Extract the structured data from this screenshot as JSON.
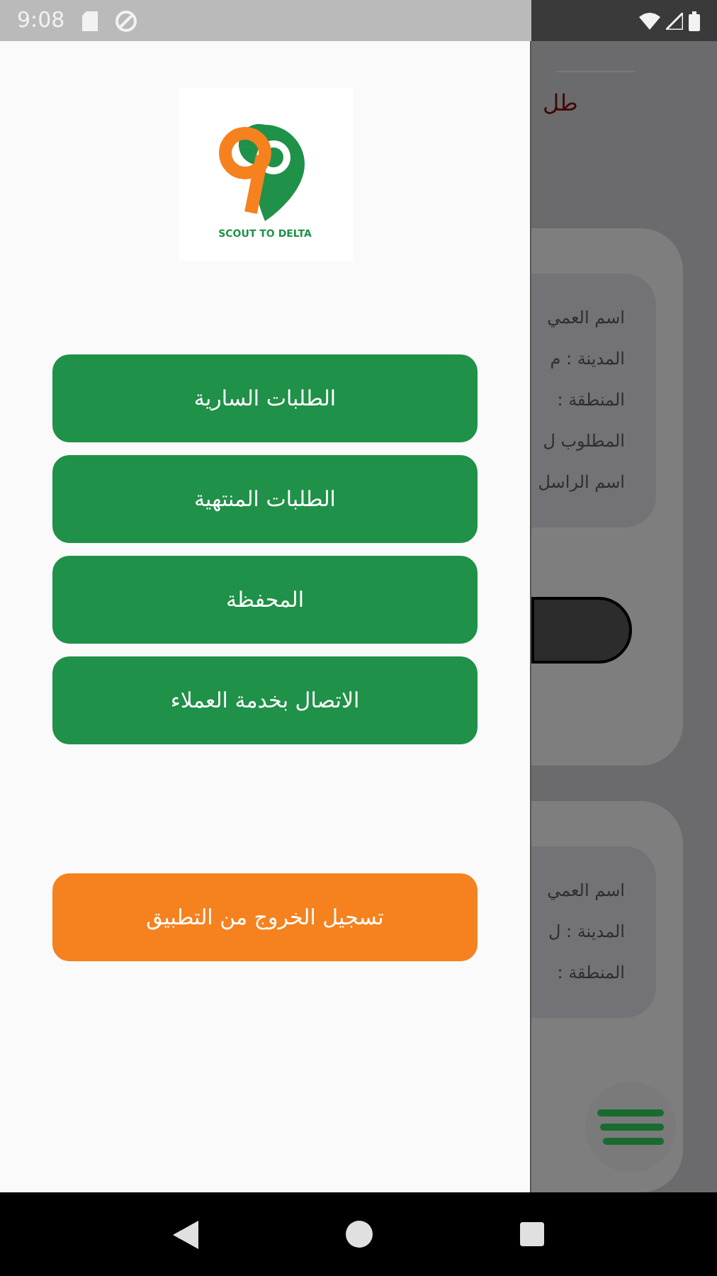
{
  "status_bar": {
    "time": "9:08"
  },
  "drawer": {
    "logo": {
      "caption": "SCOUT TO DELTA"
    },
    "menu": [
      {
        "label": "الطلبات السارية"
      },
      {
        "label": "الطلبات المنتهية"
      },
      {
        "label": "المحفظة"
      },
      {
        "label": "الاتصال بخدمة العملاء"
      }
    ],
    "logout": {
      "label": "تسجيل الخروج من التطبيق"
    }
  },
  "background": {
    "header_title": "طل",
    "cards": [
      {
        "lines": [
          "اسم العمي",
          "المدينة : م",
          "المنطقة :",
          "المطلوب ل",
          "اسم الراسل"
        ],
        "action_button": true
      },
      {
        "lines": [
          "اسم العمي",
          "المدينة : ل",
          "المنطقة :"
        ],
        "action_button": false
      }
    ]
  }
}
